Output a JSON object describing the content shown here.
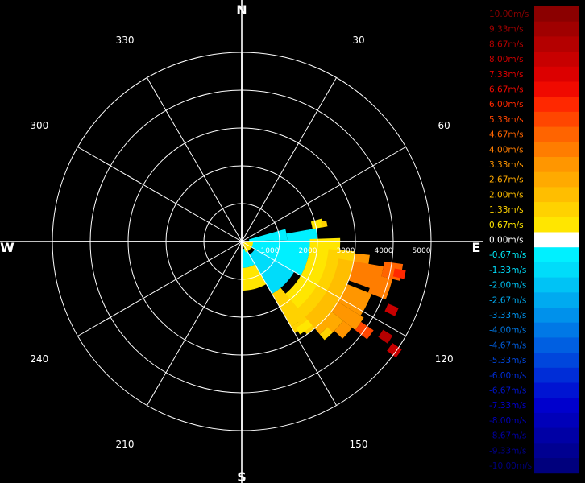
{
  "chart_data": {
    "type": "heatmap",
    "subtype": "polar-velocity-display",
    "background": "#000000",
    "grid_color": "#ffffff",
    "cardinal_labels": [
      "N",
      "E",
      "S",
      "W"
    ],
    "bearing_labels": [
      "30",
      "60",
      "120",
      "150",
      "210",
      "240",
      "300",
      "330"
    ],
    "range_rings": [
      1000,
      2000,
      3000,
      4000,
      5000
    ],
    "range_labels_shown": [
      "1000",
      "2000",
      "3000",
      "4000",
      "5000"
    ],
    "legend_position": "right",
    "legend": [
      {
        "label": "10.00m/s",
        "value": 10.0,
        "color": "#8b0000"
      },
      {
        "label": "9.33m/s",
        "value": 9.33,
        "color": "#a00000"
      },
      {
        "label": "8.67m/s",
        "value": 8.67,
        "color": "#b40000"
      },
      {
        "label": "8.00m/s",
        "value": 8.0,
        "color": "#c80000"
      },
      {
        "label": "7.33m/s",
        "value": 7.33,
        "color": "#dc0000"
      },
      {
        "label": "6.67m/s",
        "value": 6.67,
        "color": "#f00a00"
      },
      {
        "label": "6.00m/s",
        "value": 6.0,
        "color": "#ff2800"
      },
      {
        "label": "5.33m/s",
        "value": 5.33,
        "color": "#ff4600"
      },
      {
        "label": "4.67m/s",
        "value": 4.67,
        "color": "#ff6400"
      },
      {
        "label": "4.00m/s",
        "value": 4.0,
        "color": "#ff7d00"
      },
      {
        "label": "3.33m/s",
        "value": 3.33,
        "color": "#ff9600"
      },
      {
        "label": "2.67m/s",
        "value": 2.67,
        "color": "#ffaa00"
      },
      {
        "label": "2.00m/s",
        "value": 2.0,
        "color": "#ffbe00"
      },
      {
        "label": "1.33m/s",
        "value": 1.33,
        "color": "#ffd200"
      },
      {
        "label": "0.67m/s",
        "value": 0.67,
        "color": "#ffe600"
      },
      {
        "label": "0.00m/s",
        "value": 0.0,
        "color": "#ffffff"
      },
      {
        "label": "-0.67m/s",
        "value": -0.67,
        "color": "#00f0ff"
      },
      {
        "label": "-1.33m/s",
        "value": -1.33,
        "color": "#00dcfa"
      },
      {
        "label": "-2.00m/s",
        "value": -2.0,
        "color": "#00c3f5"
      },
      {
        "label": "-2.67m/s",
        "value": -2.67,
        "color": "#00aaf0"
      },
      {
        "label": "-3.33m/s",
        "value": -3.33,
        "color": "#0091eb"
      },
      {
        "label": "-4.00m/s",
        "value": -4.0,
        "color": "#0078e6"
      },
      {
        "label": "-4.67m/s",
        "value": -4.67,
        "color": "#005fe1"
      },
      {
        "label": "-5.33m/s",
        "value": -5.33,
        "color": "#0046dc"
      },
      {
        "label": "-6.00m/s",
        "value": -6.0,
        "color": "#002dd7"
      },
      {
        "label": "-6.67m/s",
        "value": -6.67,
        "color": "#0014d2"
      },
      {
        "label": "-7.33m/s",
        "value": -7.33,
        "color": "#0000cd"
      },
      {
        "label": "-8.00m/s",
        "value": -8.0,
        "color": "#0000b9"
      },
      {
        "label": "-8.67m/s",
        "value": -8.67,
        "color": "#0000a5"
      },
      {
        "label": "-9.33m/s",
        "value": -9.33,
        "color": "#000091"
      },
      {
        "label": "-10.00m/s",
        "value": -10.0,
        "color": "#00007d"
      }
    ],
    "sectors": [
      {
        "az_from": 74,
        "az_to": 88,
        "r_from": 200,
        "r_to": 1200,
        "value": -0.67
      },
      {
        "az_from": 88,
        "az_to": 120,
        "r_from": 200,
        "r_to": 1800,
        "value": -0.67
      },
      {
        "az_from": 120,
        "az_to": 150,
        "r_from": 400,
        "r_to": 1600,
        "value": -1.33
      },
      {
        "az_from": 150,
        "az_to": 180,
        "r_from": 200,
        "r_to": 700,
        "value": -0.67
      },
      {
        "az_from": 90,
        "az_to": 160,
        "r_from": 0,
        "r_to": 300,
        "value": 0.67
      },
      {
        "az_from": 80,
        "az_to": 100,
        "r_from": 1200,
        "r_to": 2000,
        "value": -0.67
      },
      {
        "az_from": 150,
        "az_to": 180,
        "r_from": 700,
        "r_to": 1300,
        "value": 0.67
      },
      {
        "az_from": 88,
        "az_to": 150,
        "r_from": 1800,
        "r_to": 2600,
        "value": 0.67
      },
      {
        "az_from": 95,
        "az_to": 145,
        "r_from": 2300,
        "r_to": 3000,
        "value": 1.33
      },
      {
        "az_from": 100,
        "az_to": 140,
        "r_from": 2600,
        "r_to": 3000,
        "value": 2.0
      },
      {
        "az_from": 140,
        "az_to": 150,
        "r_from": 1600,
        "r_to": 2600,
        "value": 1.33
      },
      {
        "az_from": 74,
        "az_to": 80,
        "r_from": 1900,
        "r_to": 2200,
        "value": 0.67
      },
      {
        "az_from": 96,
        "az_to": 104,
        "r_from": 3000,
        "r_to": 3400,
        "value": 3.33
      },
      {
        "az_from": 100,
        "az_to": 110,
        "r_from": 3000,
        "r_to": 3800,
        "value": 4.0
      },
      {
        "az_from": 98,
        "az_to": 104,
        "r_from": 3800,
        "r_to": 4300,
        "value": 4.67
      },
      {
        "az_from": 104,
        "az_to": 112,
        "r_from": 3600,
        "r_to": 4100,
        "value": 4.0
      },
      {
        "az_from": 112,
        "az_to": 122,
        "r_from": 3000,
        "r_to": 3700,
        "value": 3.33
      },
      {
        "az_from": 122,
        "az_to": 128,
        "r_from": 3000,
        "r_to": 3800,
        "value": 3.33
      },
      {
        "az_from": 124,
        "az_to": 128,
        "r_from": 3800,
        "r_to": 4200,
        "value": 5.33
      },
      {
        "az_from": 128,
        "az_to": 136,
        "r_from": 3000,
        "r_to": 3400,
        "value": 2.67
      },
      {
        "az_from": 134,
        "az_to": 140,
        "r_from": 3000,
        "r_to": 3200,
        "value": 2.67
      },
      {
        "az_from": 140,
        "az_to": 150,
        "r_from": 2600,
        "r_to": 2800,
        "value": 1.33
      },
      {
        "az_from": 113,
        "az_to": 116,
        "r_from": 4200,
        "r_to": 4500,
        "value": 8.0
      },
      {
        "az_from": 122,
        "az_to": 125,
        "r_from": 4400,
        "r_to": 4700,
        "value": 8.67
      },
      {
        "az_from": 124,
        "az_to": 127,
        "r_from": 4800,
        "r_to": 5100,
        "value": 8.0
      },
      {
        "az_from": 100,
        "az_to": 103,
        "r_from": 4100,
        "r_to": 4400,
        "value": 6.0
      },
      {
        "az_from": 140,
        "az_to": 148,
        "r_from": 2700,
        "r_to": 2900,
        "value": 0.67
      },
      {
        "az_from": 135,
        "az_to": 140,
        "r_from": 3200,
        "r_to": 3400,
        "value": 1.33
      },
      {
        "az_from": 76,
        "az_to": 80,
        "r_from": 2150,
        "r_to": 2300,
        "value": 1.33
      },
      {
        "az_from": 128,
        "az_to": 134,
        "r_from": 3400,
        "r_to": 3700,
        "value": 3.33
      }
    ]
  }
}
